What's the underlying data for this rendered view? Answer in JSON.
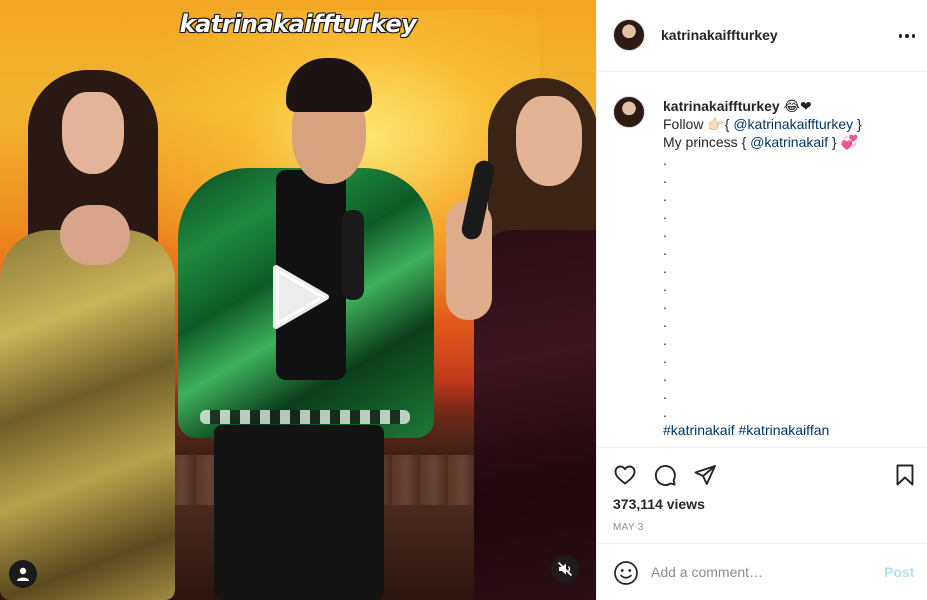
{
  "media": {
    "watermark": "katrinakaiffturkey",
    "play_icon": "play-icon",
    "user_tag_icon": "user-icon",
    "mute_icon": "muted-speaker-icon"
  },
  "post": {
    "username": "katrinakaiffturkey",
    "more_icon": "more-options-icon"
  },
  "caption": {
    "username": "katrinakaiffturkey",
    "username_emoji": "😂❤",
    "line1_prefix": "Follow 👉🏻{ ",
    "line1_mention": "@katrinakaiffturkey",
    "line1_suffix": " }",
    "line2_prefix": "My princess { ",
    "line2_mention": "@katrinakaif",
    "line2_suffix": " } 💞",
    "dots": [
      ".",
      ".",
      ".",
      ".",
      ".",
      ".",
      ".",
      ".",
      ".",
      ".",
      ".",
      ".",
      ".",
      ".",
      "."
    ],
    "hashtags": "#katrinakaif #katrinakaiffan"
  },
  "actions": {
    "like_icon": "heart-icon",
    "comment_icon": "comment-icon",
    "share_icon": "paper-plane-icon",
    "save_icon": "bookmark-icon",
    "views": "373,114 views",
    "date": "MAY 3"
  },
  "comment": {
    "emoji_icon": "emoji-icon",
    "placeholder": "Add a comment…",
    "post_label": "Post"
  },
  "colors": {
    "link": "#00376b",
    "post_button_disabled": "#b2dffc",
    "muted_text": "#8e8e8e",
    "border": "#efefef"
  }
}
